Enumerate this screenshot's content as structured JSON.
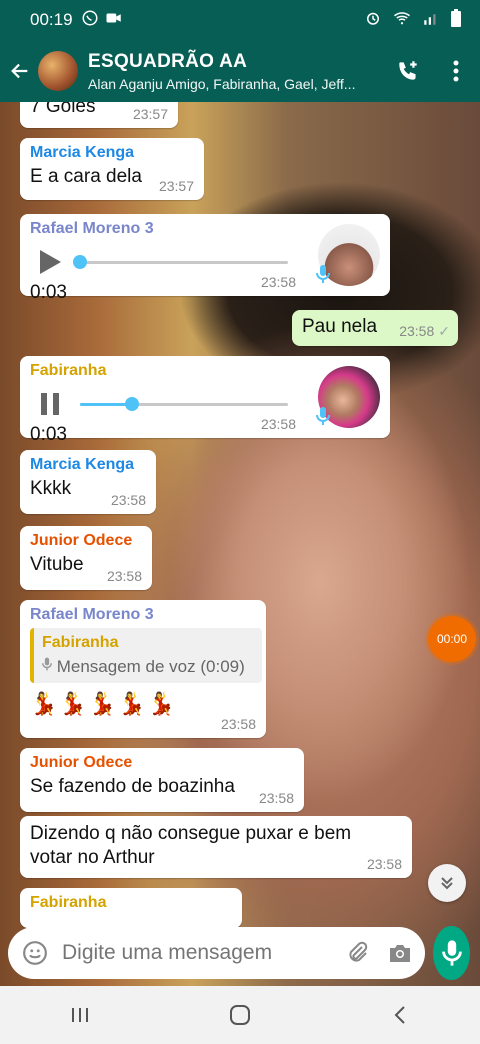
{
  "status_bar": {
    "time": "00:19"
  },
  "header": {
    "group_name": "ESQUADRÃO AA",
    "members": "Alan Aganju Amigo, Fabiranha, Gael, Jeff..."
  },
  "messages": [
    {
      "type": "text",
      "text": "7 Goles",
      "time": "23:57"
    },
    {
      "type": "text",
      "sender": "Marcia Kenga",
      "sender_color": "#1e88e5",
      "text": "E a cara dela",
      "time": "23:57"
    },
    {
      "type": "voice",
      "sender": "Rafael Moreno 3",
      "sender_color": "#7986cb",
      "duration": "0:03",
      "progress": 0.0,
      "time": "23:58",
      "playing": false
    },
    {
      "type": "text_out",
      "text": "Pau nela",
      "time": "23:58"
    },
    {
      "type": "voice",
      "sender": "Fabiranha",
      "sender_color": "#d4a300",
      "duration": "0:03",
      "progress": 0.25,
      "time": "23:58",
      "playing": true
    },
    {
      "type": "text",
      "sender": "Marcia Kenga",
      "sender_color": "#1e88e5",
      "text": "Kkkk",
      "time": "23:58"
    },
    {
      "type": "text",
      "sender": "Junior Odece",
      "sender_color": "#e65100",
      "text": "Vitube",
      "time": "23:58"
    },
    {
      "type": "reply",
      "sender": "Rafael Moreno 3",
      "sender_color": "#7986cb",
      "quoted_sender": "Fabiranha",
      "quoted_text": "Mensagem de voz (0:09)",
      "text": "💃💃💃💃💃",
      "time": "23:58"
    },
    {
      "type": "text",
      "sender": "Junior Odece",
      "sender_color": "#e65100",
      "text": "Se fazendo de boazinha",
      "time": "23:58"
    },
    {
      "type": "text",
      "text": "Dizendo q não consegue puxar e bem votar no Arthur",
      "time": "23:58"
    },
    {
      "type": "text",
      "sender": "Fabiranha",
      "sender_color": "#d4a300"
    }
  ],
  "floating_timer": "00:00",
  "composer": {
    "placeholder": "Digite uma mensagem"
  }
}
